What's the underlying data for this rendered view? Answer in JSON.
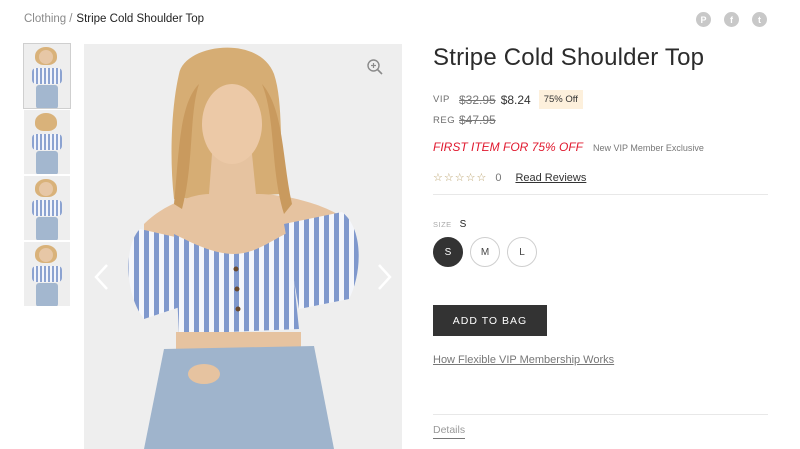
{
  "breadcrumb": {
    "parent": "Clothing",
    "separator": "/",
    "current": "Stripe Cold Shoulder Top"
  },
  "social": [
    {
      "icon": "pinterest-icon",
      "glyph": "P"
    },
    {
      "icon": "facebook-icon",
      "glyph": "f"
    },
    {
      "icon": "twitter-icon",
      "glyph": "t"
    }
  ],
  "product": {
    "title": "Stripe Cold Shoulder Top",
    "vip_label": "VIP",
    "vip_original_price": "$32.95",
    "vip_price": "$8.24",
    "discount_badge": "75% Off",
    "reg_label": "REG",
    "reg_price": "$47.95",
    "promo_text": "FIRST ITEM FOR 75% OFF",
    "promo_sub": "New VIP Member Exclusive",
    "stars": "☆☆☆☆☆",
    "rating_value": 0,
    "review_count": "0",
    "reviews_link": "Read Reviews"
  },
  "size": {
    "label": "SIZE",
    "selected": "S",
    "options": [
      "S",
      "M",
      "L"
    ]
  },
  "add_to_bag": "ADD TO BAG",
  "vip_link": "How Flexible VIP Membership Works",
  "details_tab": "Details",
  "colors": {
    "accent": "#e0182e",
    "button": "#333333",
    "badge": "#fdf0dc",
    "stripe": "#7f98cd"
  }
}
